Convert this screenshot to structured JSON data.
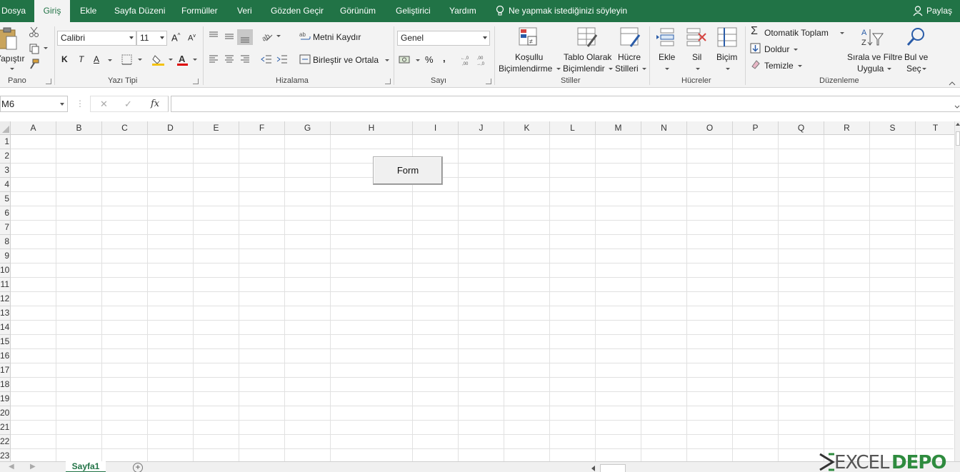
{
  "tabs": [
    {
      "label": "Dosya",
      "active": false
    },
    {
      "label": "Giriş",
      "active": true
    },
    {
      "label": "Ekle",
      "active": false
    },
    {
      "label": "Sayfa Düzeni",
      "active": false
    },
    {
      "label": "Formüller",
      "active": false
    },
    {
      "label": "Veri",
      "active": false
    },
    {
      "label": "Gözden Geçir",
      "active": false
    },
    {
      "label": "Görünüm",
      "active": false
    },
    {
      "label": "Geliştirici",
      "active": false
    },
    {
      "label": "Yardım",
      "active": false
    }
  ],
  "tell_me": "Ne yapmak istediğinizi söyleyin",
  "share": "Paylaş",
  "ribbon": {
    "clipboard": {
      "paste": "Yapıştır",
      "group": "Pano"
    },
    "font": {
      "name": "Calibri",
      "size": "11",
      "bold": "K",
      "italic": "T",
      "underline": "A",
      "group": "Yazı Tipi"
    },
    "alignment": {
      "wrap": "Metni Kaydır",
      "merge": "Birleştir ve Ortala",
      "group": "Hizalama"
    },
    "number": {
      "format": "Genel",
      "percent": "%",
      "comma": ",",
      "group": "Sayı"
    },
    "styles": {
      "conditional": [
        "Koşullu",
        "Biçimlendirme"
      ],
      "table": [
        "Tablo Olarak",
        "Biçimlendir"
      ],
      "cell": [
        "Hücre",
        "Stilleri"
      ],
      "group": "Stiller"
    },
    "cells": {
      "insert": "Ekle",
      "delete": "Sil",
      "format": "Biçim",
      "group": "Hücreler"
    },
    "editing": {
      "autosum": "Otomatik Toplam",
      "fill": "Doldur",
      "clear": "Temizle",
      "sort": [
        "Sırala ve Filtre",
        "Uygula"
      ],
      "find": [
        "Bul ve",
        "Seç"
      ],
      "group": "Düzenleme"
    }
  },
  "formula_bar": {
    "name_box": "M6",
    "fx": "fx",
    "value": ""
  },
  "columns": [
    "A",
    "B",
    "C",
    "D",
    "E",
    "F",
    "G",
    "H",
    "I",
    "J",
    "K",
    "L",
    "M",
    "N",
    "O",
    "P",
    "Q",
    "R",
    "S",
    "T"
  ],
  "rows": [
    "1",
    "2",
    "3",
    "4",
    "5",
    "6",
    "7",
    "8",
    "9",
    "10",
    "11",
    "12",
    "13",
    "14",
    "15",
    "16",
    "17",
    "18",
    "19",
    "20",
    "21",
    "22",
    "23"
  ],
  "form_button": "Form",
  "sheets": [
    {
      "name": "Sayfa1",
      "active": true
    }
  ],
  "watermark": "EXCEL DEPO",
  "colors": {
    "accent": "#217346",
    "ribbon_bg": "#f3f3f3",
    "grid_line": "#e1e1e1"
  }
}
